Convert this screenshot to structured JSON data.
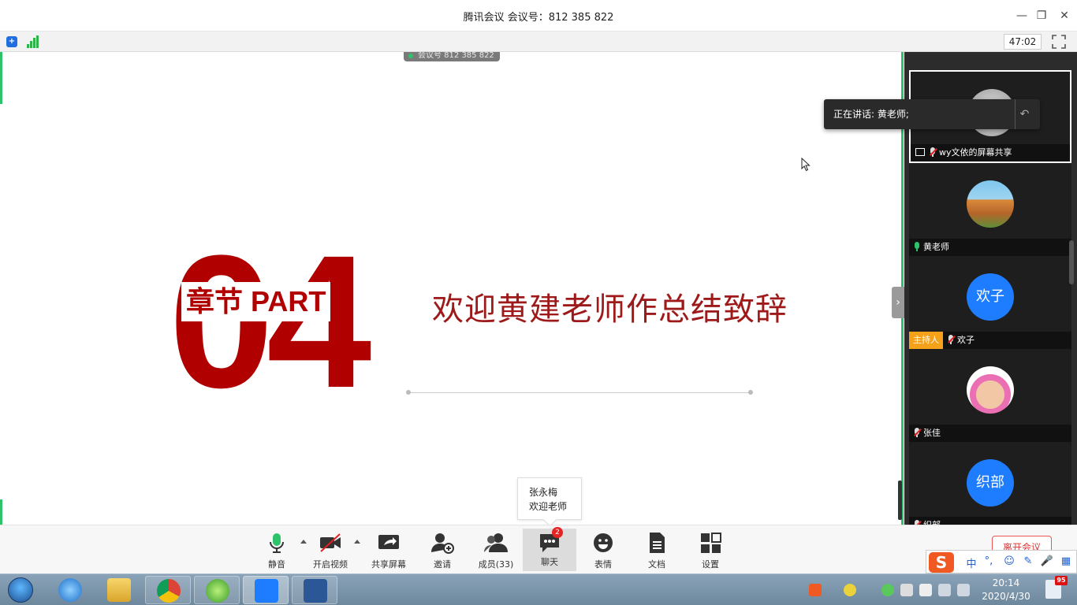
{
  "window": {
    "title": "腾讯会议 会议号：812 385 822",
    "minimize": "—",
    "restore": "❐",
    "close": "✕"
  },
  "infobar": {
    "timer": "47:02",
    "shield": "+"
  },
  "share": {
    "meeting_pill": "会议号 812 385 822",
    "big_number_a": "0",
    "big_number_b": "4",
    "chapter_label": "章节 PART",
    "slide_title": "欢迎黄建老师作总结致辞",
    "collapse_arrow": "›"
  },
  "speaking": {
    "text": "正在讲话: 黄老师;",
    "reply": "↶"
  },
  "participants": [
    {
      "name": "wy文依的屏幕共享",
      "mic": "muted",
      "sharing": true,
      "active": true,
      "avatar": "gray"
    },
    {
      "name": "黄老师",
      "mic": "on",
      "avatar": "photo-building"
    },
    {
      "name": "欢子",
      "mic": "muted",
      "host": true,
      "host_label": "主持人",
      "avatar_text": "欢子"
    },
    {
      "name": "张佳",
      "mic": "muted",
      "avatar": "photo-cartoon"
    },
    {
      "name": "织部",
      "mic": "muted",
      "avatar_text": "织部"
    }
  ],
  "chat_popup": {
    "sender": "张永梅",
    "message": "欢迎老师"
  },
  "toolbar": {
    "mute": "静音",
    "video": "开启视频",
    "share": "共享屏幕",
    "invite": "邀请",
    "members": "成员(33)",
    "chat": "聊天",
    "chat_badge": "2",
    "emoji": "表情",
    "docs": "文档",
    "settings": "设置",
    "leave": "离开会议"
  },
  "ime": {
    "logo": "S",
    "lang": "中",
    "punct": "°,",
    "emoji": "☺",
    "pen": "✎",
    "voice": "🎤",
    "grid": "▦"
  },
  "taskbar": {
    "time": "20:14",
    "date": "2020/4/30",
    "notify_badge": "95"
  },
  "colors": {
    "accent_green": "#2ec36b",
    "slide_red": "#b00000",
    "host_orange": "#f5a11a",
    "avatar_blue": "#1e7dff"
  }
}
